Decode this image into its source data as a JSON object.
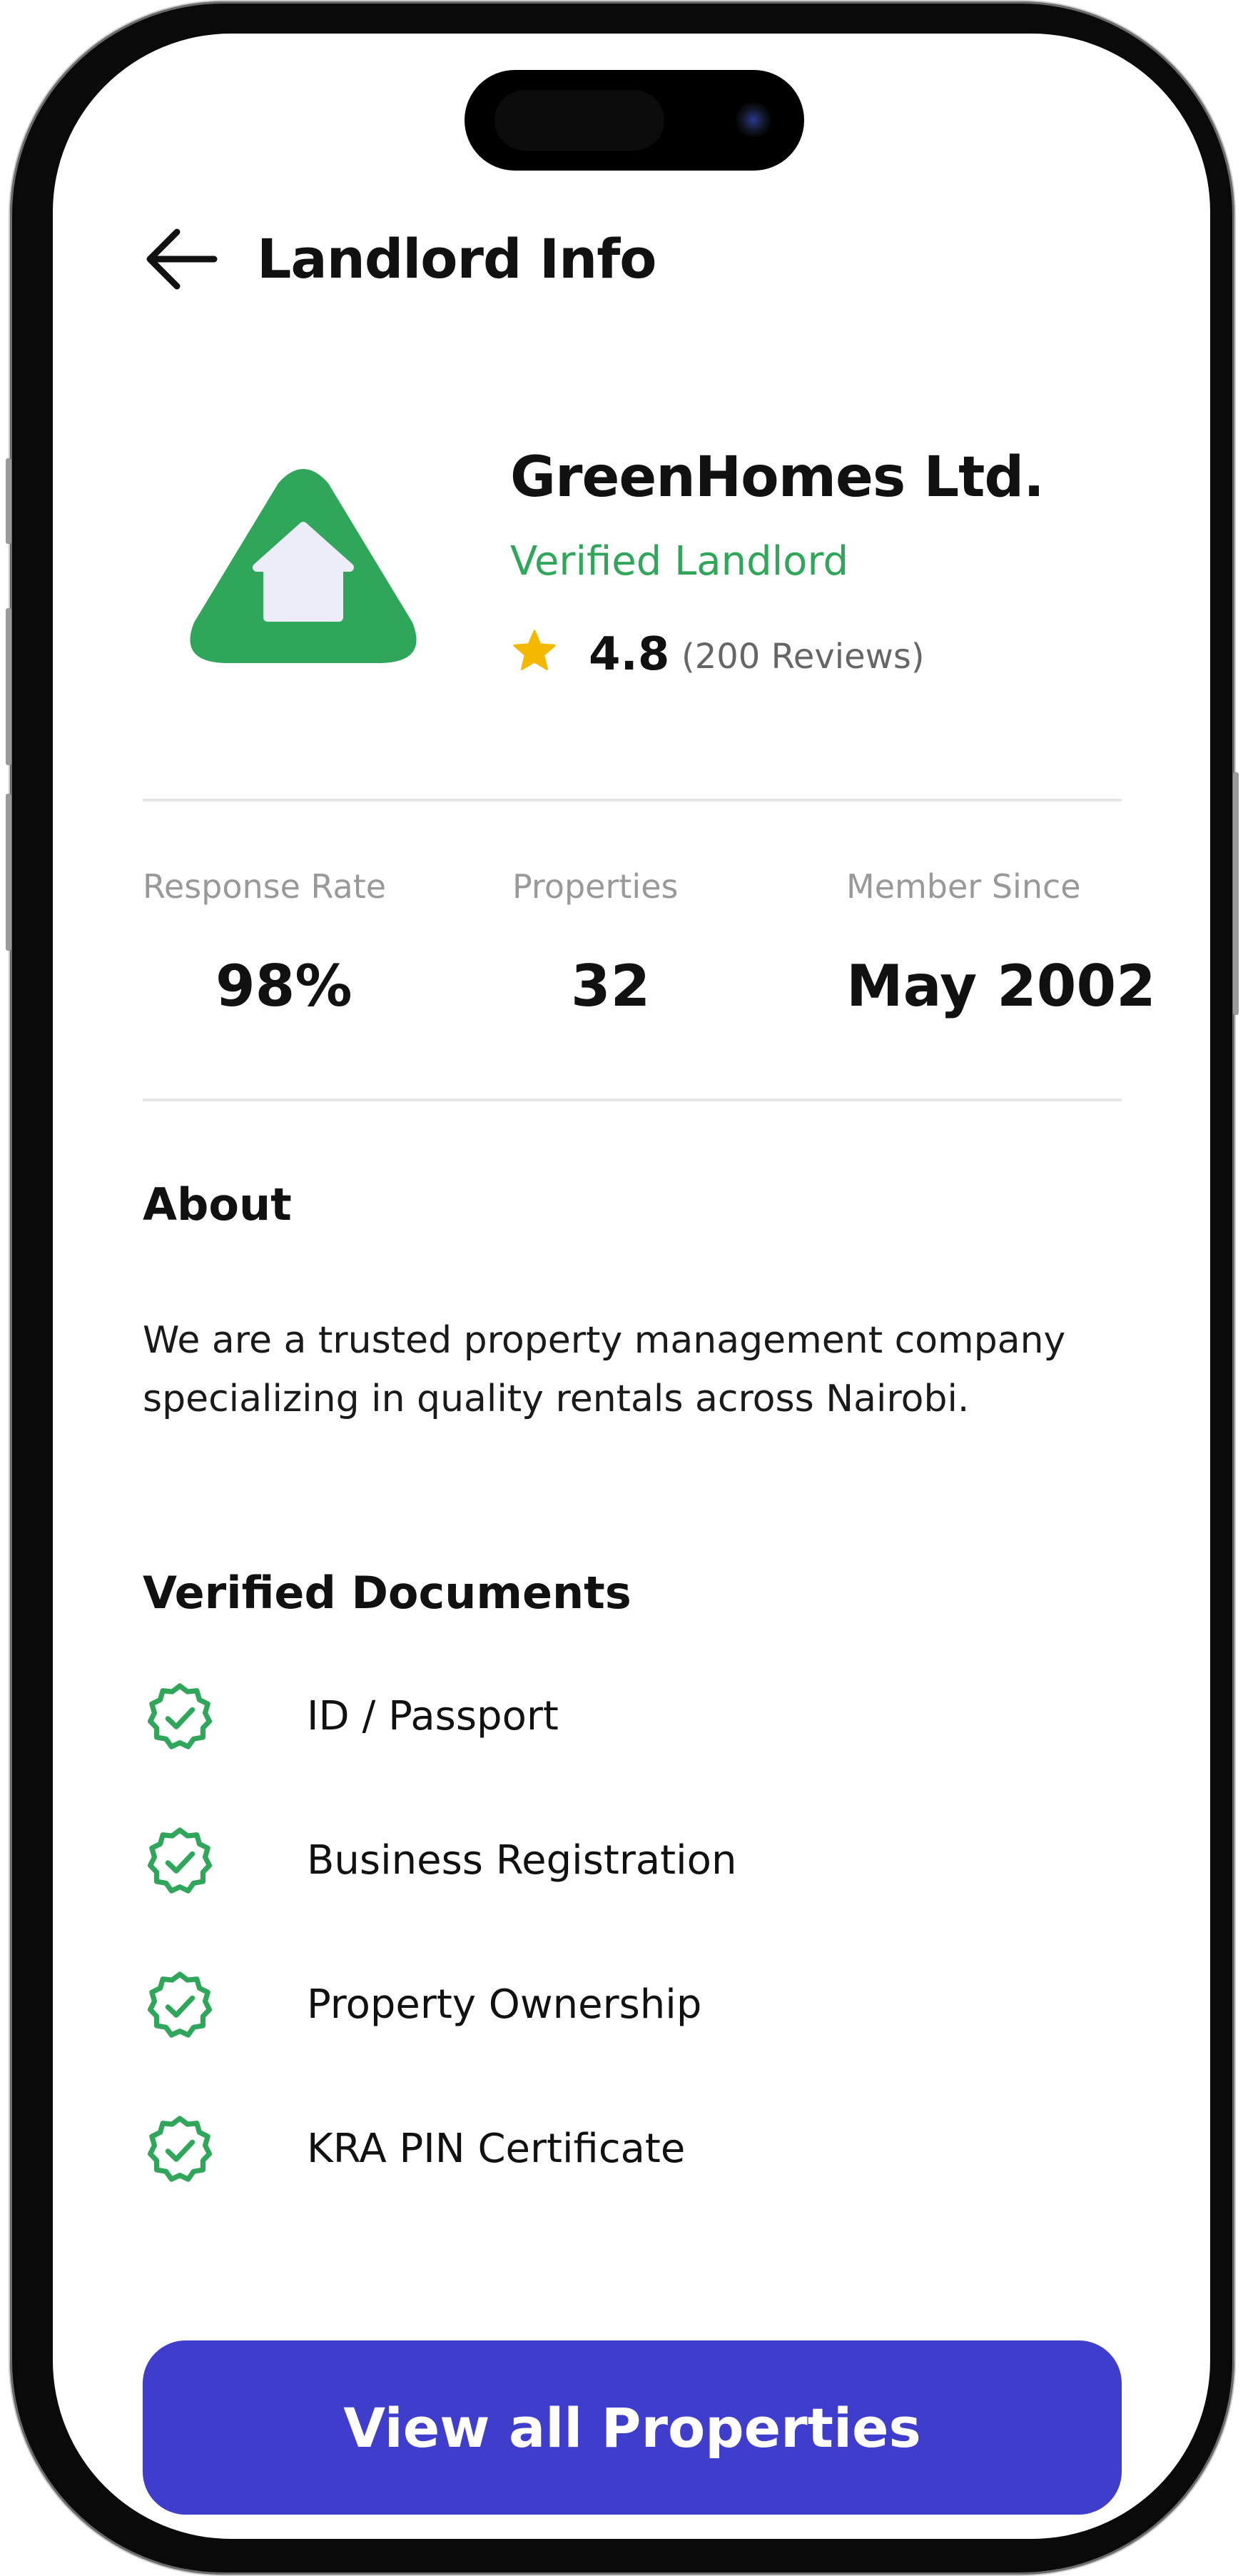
{
  "header": {
    "title": "Landlord Info"
  },
  "profile": {
    "company_name": "GreenHomes Ltd.",
    "verified_label": "Verified Landlord",
    "rating": "4.8",
    "reviews": "(200 Reviews)"
  },
  "stats": [
    {
      "label": "Response Rate",
      "value": "98%"
    },
    {
      "label": "Properties",
      "value": "32"
    },
    {
      "label": "Member Since",
      "value": "May 2002"
    }
  ],
  "about": {
    "title": "About",
    "text": "We are a trusted property management company specializing in quality rentals across Nairobi."
  },
  "documents": {
    "title": "Verified Documents",
    "items": [
      {
        "label": "ID / Passport",
        "icon": "verified-check-icon"
      },
      {
        "label": "Business Registration",
        "icon": "verified-check-icon"
      },
      {
        "label": "Property Ownership",
        "icon": "verified-check-icon"
      },
      {
        "label": "KRA PIN Certificate",
        "icon": "verified-check-icon"
      }
    ]
  },
  "cta": {
    "label": "View all Properties"
  },
  "colors": {
    "accent_green": "#2fa65a",
    "primary_button": "#3f3dcc",
    "star": "#f5b800"
  }
}
